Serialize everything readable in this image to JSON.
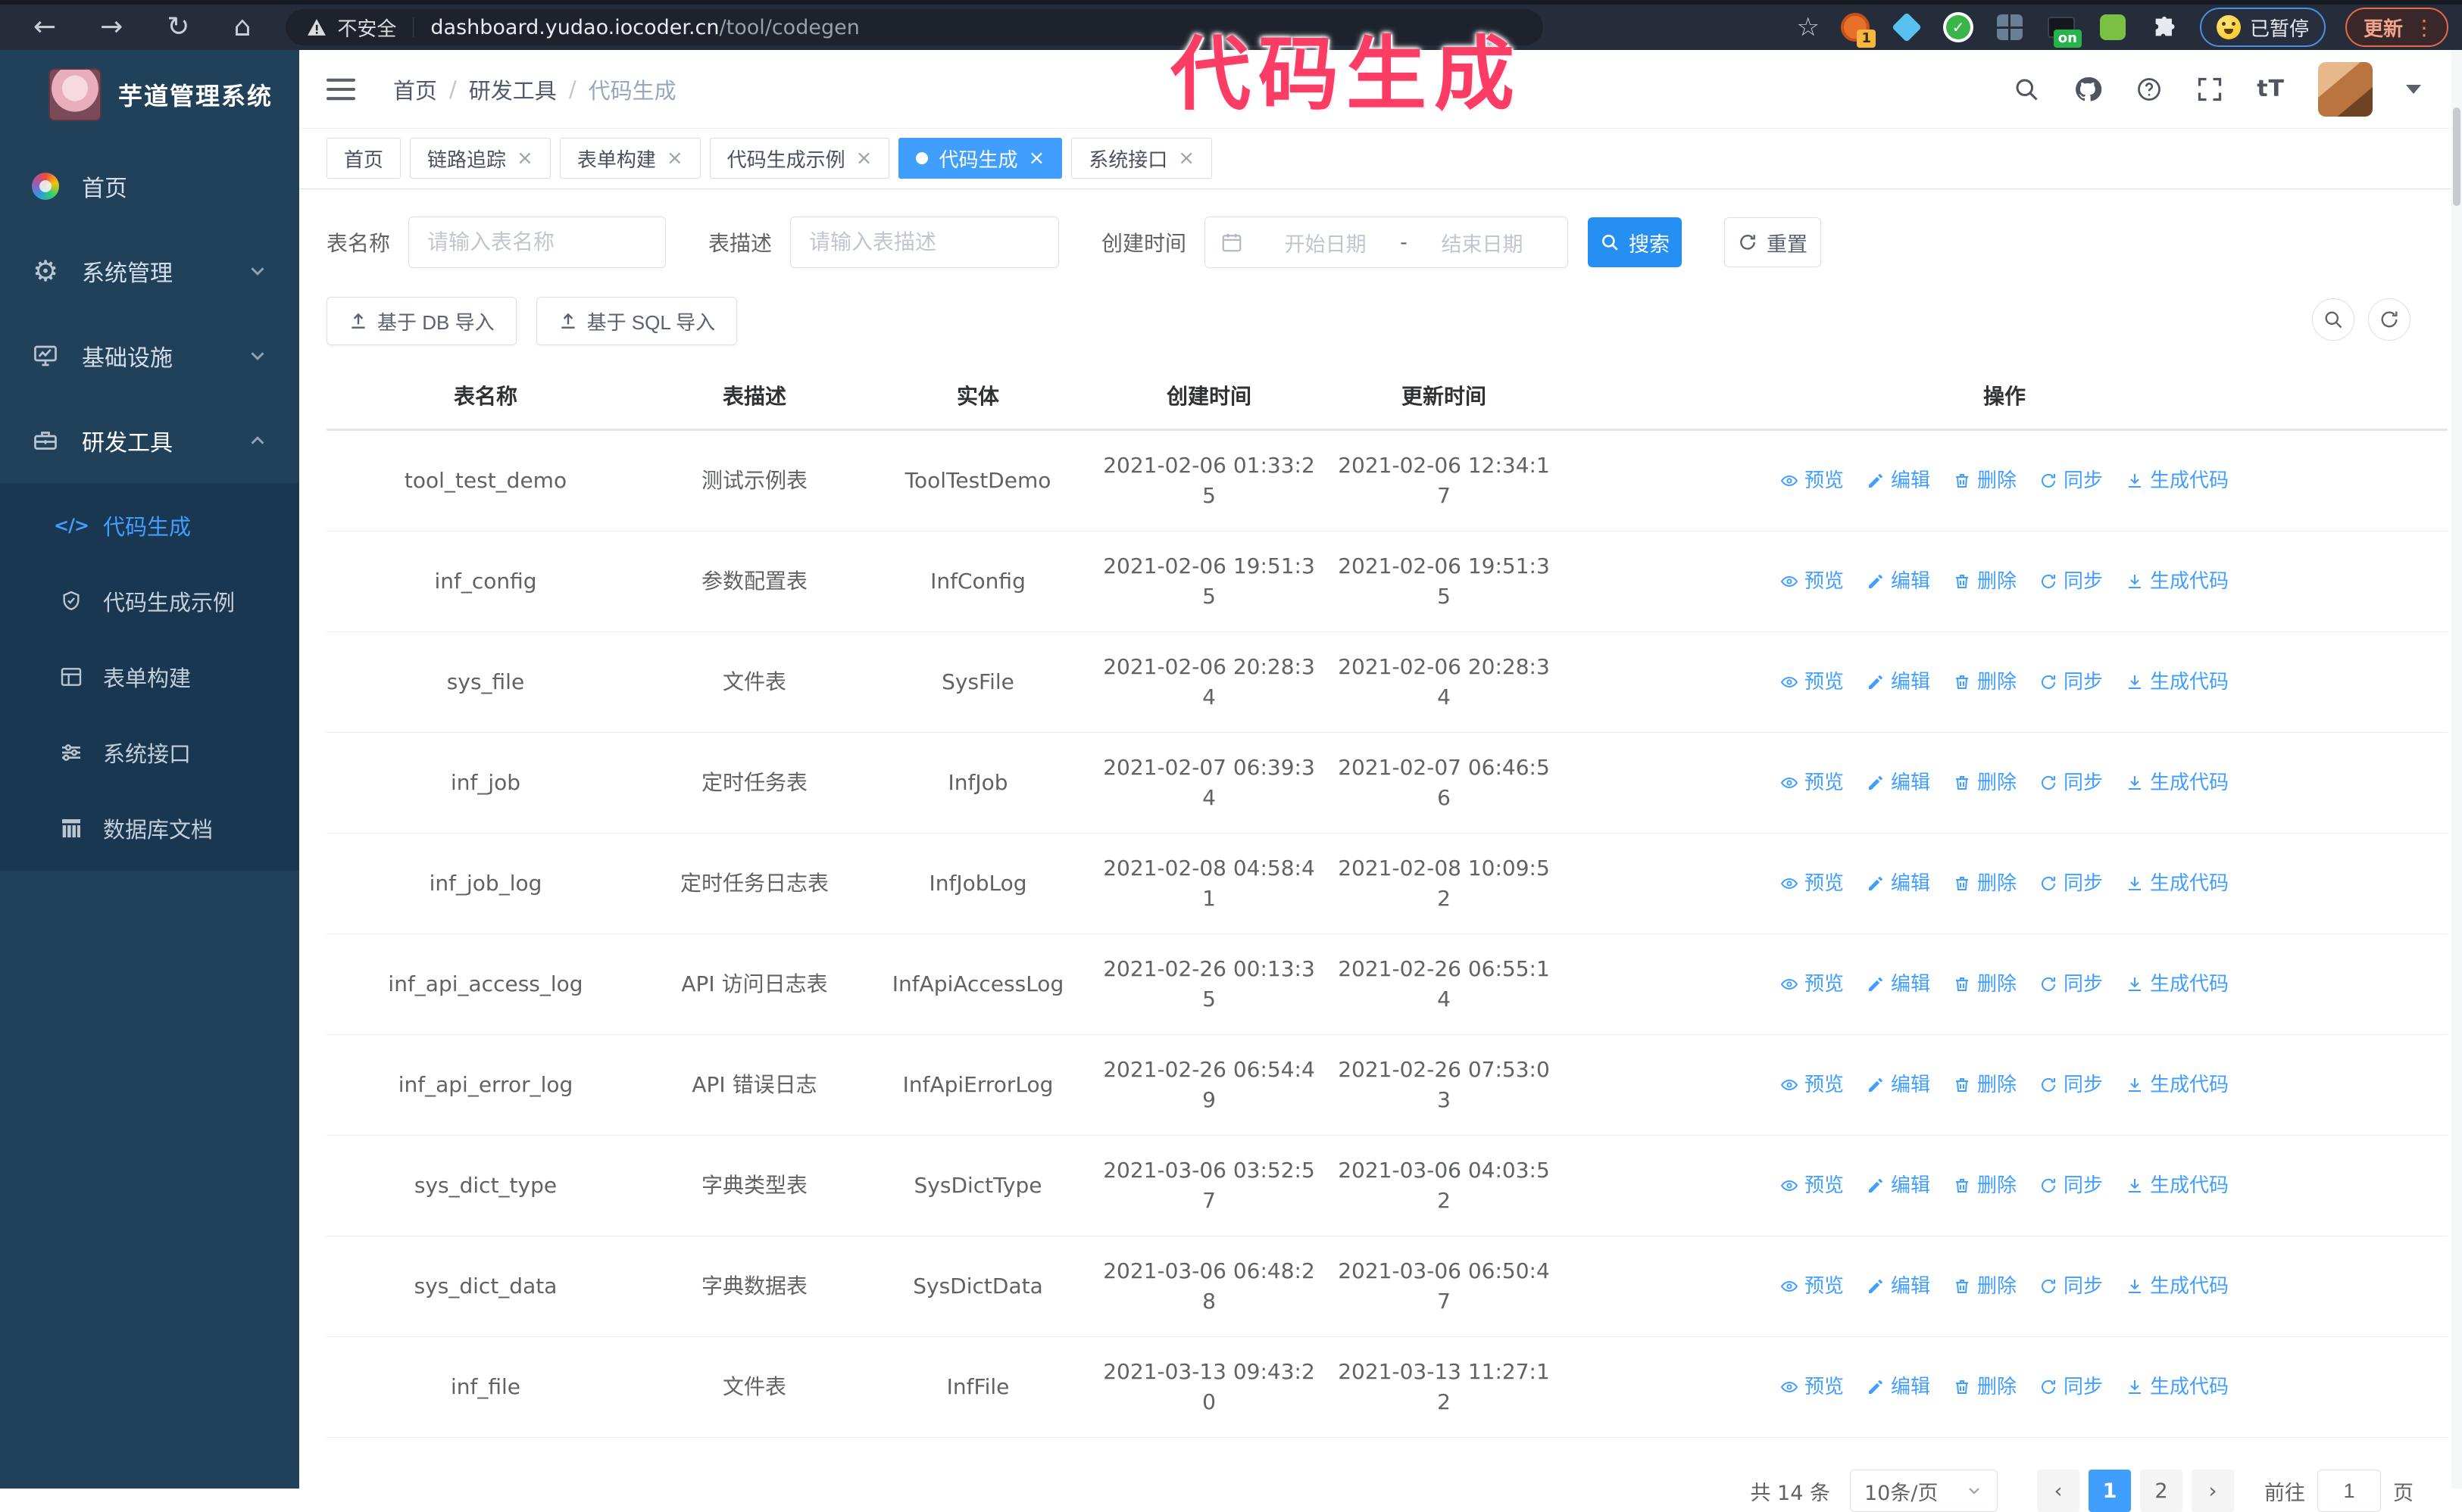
{
  "browser": {
    "security_label": "不安全",
    "url_host": "dashboard.yudao.iocoder.cn",
    "url_path": "/tool/codegen",
    "ext_badge_count": "1",
    "ext_badge_on": "on",
    "paused_badge": "已暂停",
    "update_badge": "更新"
  },
  "overlay": {
    "title": "代码生成"
  },
  "sidebar": {
    "title": "芋道管理系统",
    "items": [
      {
        "label": "首页",
        "icon": "dashboard-icon"
      },
      {
        "label": "系统管理",
        "icon": "gear-icon",
        "chevron": "down"
      },
      {
        "label": "基础设施",
        "icon": "monitor-icon",
        "chevron": "down"
      },
      {
        "label": "研发工具",
        "icon": "toolbox-icon",
        "chevron": "up"
      }
    ],
    "subitems": [
      {
        "label": "代码生成",
        "icon": "code-icon",
        "active": true
      },
      {
        "label": "代码生成示例",
        "icon": "shield-check-icon"
      },
      {
        "label": "表单构建",
        "icon": "form-icon"
      },
      {
        "label": "系统接口",
        "icon": "sliders-icon"
      },
      {
        "label": "数据库文档",
        "icon": "database-icon"
      }
    ]
  },
  "header": {
    "breadcrumb": [
      "首页",
      "研发工具",
      "代码生成"
    ]
  },
  "tabs": [
    {
      "label": "首页"
    },
    {
      "label": "链路追踪"
    },
    {
      "label": "表单构建"
    },
    {
      "label": "代码生成示例"
    },
    {
      "label": "代码生成",
      "active": true
    },
    {
      "label": "系统接口"
    }
  ],
  "search": {
    "name_label": "表名称",
    "name_placeholder": "请输入表名称",
    "desc_label": "表描述",
    "desc_placeholder": "请输入表描述",
    "time_label": "创建时间",
    "start_placeholder": "开始日期",
    "range_separator": "-",
    "end_placeholder": "结束日期",
    "search_label": "搜索",
    "reset_label": "重置"
  },
  "toolbar": {
    "import_db_label": "基于 DB 导入",
    "import_sql_label": "基于 SQL 导入"
  },
  "table": {
    "columns": [
      "表名称",
      "表描述",
      "实体",
      "创建时间",
      "更新时间",
      "操作"
    ],
    "ops": [
      {
        "label": "预览",
        "name": "preview",
        "icon": "eye-icon"
      },
      {
        "label": "编辑",
        "name": "edit",
        "icon": "edit-pencil-icon"
      },
      {
        "label": "删除",
        "name": "delete",
        "icon": "trash-icon"
      },
      {
        "label": "同步",
        "name": "sync",
        "icon": "sync-icon"
      },
      {
        "label": "生成代码",
        "name": "generate-code",
        "icon": "download-icon"
      }
    ],
    "rows": [
      {
        "name": "tool_test_demo",
        "desc": "测试示例表",
        "entity": "ToolTestDemo",
        "created": "2021-02-06 01:33:25",
        "updated": "2021-02-06 12:34:17"
      },
      {
        "name": "inf_config",
        "desc": "参数配置表",
        "entity": "InfConfig",
        "created": "2021-02-06 19:51:35",
        "updated": "2021-02-06 19:51:35"
      },
      {
        "name": "sys_file",
        "desc": "文件表",
        "entity": "SysFile",
        "created": "2021-02-06 20:28:34",
        "updated": "2021-02-06 20:28:34"
      },
      {
        "name": "inf_job",
        "desc": "定时任务表",
        "entity": "InfJob",
        "created": "2021-02-07 06:39:34",
        "updated": "2021-02-07 06:46:56"
      },
      {
        "name": "inf_job_log",
        "desc": "定时任务日志表",
        "entity": "InfJobLog",
        "created": "2021-02-08 04:58:41",
        "updated": "2021-02-08 10:09:52"
      },
      {
        "name": "inf_api_access_log",
        "desc": "API 访问日志表",
        "entity": "InfApiAccessLog",
        "created": "2021-02-26 00:13:35",
        "updated": "2021-02-26 06:55:14"
      },
      {
        "name": "inf_api_error_log",
        "desc": "API 错误日志",
        "entity": "InfApiErrorLog",
        "created": "2021-02-26 06:54:49",
        "updated": "2021-02-26 07:53:03"
      },
      {
        "name": "sys_dict_type",
        "desc": "字典类型表",
        "entity": "SysDictType",
        "created": "2021-03-06 03:52:57",
        "updated": "2021-03-06 04:03:52"
      },
      {
        "name": "sys_dict_data",
        "desc": "字典数据表",
        "entity": "SysDictData",
        "created": "2021-03-06 06:48:28",
        "updated": "2021-03-06 06:50:47"
      },
      {
        "name": "inf_file",
        "desc": "文件表",
        "entity": "InfFile",
        "created": "2021-03-13 09:43:20",
        "updated": "2021-03-13 11:27:12"
      }
    ]
  },
  "pagination": {
    "total": "共 14 条",
    "page_size": "10条/页",
    "pages": [
      "1",
      "2"
    ],
    "active_page": "1",
    "goto_label": "前往",
    "goto_value": "1",
    "unit_label": "页"
  },
  "colors": {
    "accent": "#409eff",
    "sidebar_bg": "#21405a",
    "submenu_bg": "#193750",
    "overlay_pink": "#fb3c64",
    "chrome_bg": "#262d3a"
  }
}
